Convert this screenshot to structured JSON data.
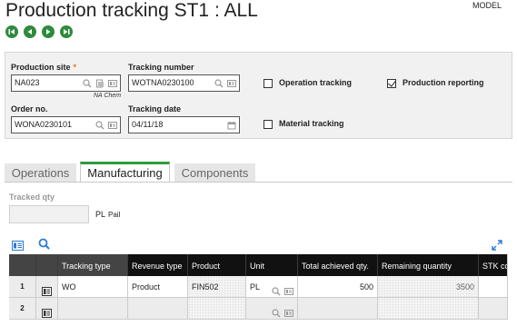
{
  "header": {
    "title": "Production tracking ST1 : ALL",
    "model_label": "MODEL"
  },
  "nav": {
    "buttons": [
      "first-icon",
      "previous-icon",
      "next-icon",
      "last-icon"
    ]
  },
  "criteria": {
    "production_site": {
      "label": "Production site",
      "required_marker": "*",
      "value": "NA023",
      "subnote": "NA Chem"
    },
    "tracking_number": {
      "label": "Tracking number",
      "value": "WOTNA0230100"
    },
    "order_no": {
      "label": "Order no.",
      "value": "WONA0230101"
    },
    "tracking_date": {
      "label": "Tracking date",
      "value": "04/11/18"
    },
    "operation_tracking": {
      "label": "Operation tracking",
      "checked": false
    },
    "production_reporting": {
      "label": "Production reporting",
      "checked": true
    },
    "material_tracking": {
      "label": "Material tracking",
      "checked": false
    }
  },
  "tabs": [
    {
      "label": "Operations",
      "active": false
    },
    {
      "label": "Manufacturing",
      "active": true
    },
    {
      "label": "Components",
      "active": false
    }
  ],
  "tracked_qty": {
    "label": "Tracked qty",
    "value": "",
    "unit": "PL",
    "unit_desc": "Pail"
  },
  "grid": {
    "columns": [
      "Tracking type",
      "Revenue type",
      "Product",
      "Unit",
      "Total achieved qty.",
      "Remaining quantity",
      "STK co"
    ],
    "rows": [
      {
        "num": "1",
        "tracking_type": "WO",
        "revenue_type": "Product",
        "product": "FIN502",
        "unit": "PL",
        "total_achieved": "500",
        "remaining": "3500",
        "stk": ""
      },
      {
        "num": "2",
        "tracking_type": "",
        "revenue_type": "",
        "product": "",
        "unit": "",
        "total_achieved": "",
        "remaining": "",
        "stk": ""
      }
    ]
  },
  "colors": {
    "accent_green": "#2e9a3f",
    "required_orange": "#e6731e",
    "grid_header": "#111111"
  }
}
